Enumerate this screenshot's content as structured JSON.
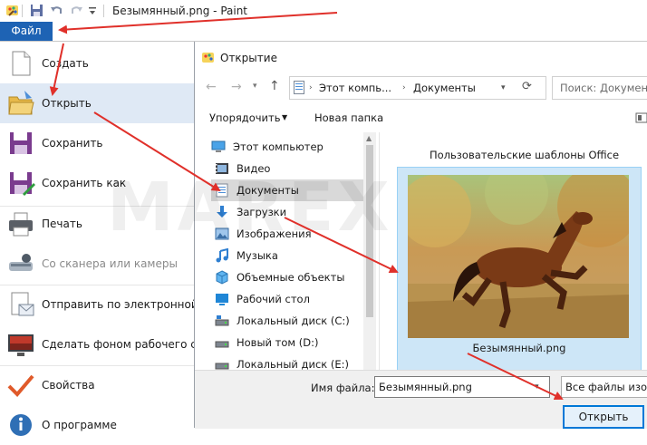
{
  "app": {
    "window_title": "Безымянный.png - Paint",
    "file_tab": "Файл"
  },
  "file_menu": {
    "items": [
      {
        "label": "Создать",
        "icon": "new-document-icon"
      },
      {
        "label": "Открыть",
        "icon": "open-folder-icon"
      },
      {
        "label": "Сохранить",
        "icon": "save-disk-icon"
      },
      {
        "label": "Сохранить как",
        "icon": "save-as-icon"
      },
      {
        "label": "Печать",
        "icon": "printer-icon"
      },
      {
        "label": "Со сканера или камеры",
        "icon": "scanner-icon"
      },
      {
        "label": "Отправить по электронной по",
        "icon": "email-icon"
      },
      {
        "label": "Сделать фоном рабочего стол",
        "icon": "desktop-background-icon"
      },
      {
        "label": "Свойства",
        "icon": "checkmark-icon"
      },
      {
        "label": "О программе",
        "icon": "info-icon"
      }
    ]
  },
  "dialog": {
    "title": "Открытие",
    "address": {
      "crumb1": "Этот компь...",
      "crumb2": "Документы",
      "search_placeholder": "Поиск: Документы"
    },
    "toolbar": {
      "organize": "Упорядочить",
      "new_folder": "Новая папка"
    },
    "nav": [
      {
        "label": "Этот компьютер",
        "icon": "computer-icon"
      },
      {
        "label": "Видео",
        "icon": "video-icon"
      },
      {
        "label": "Документы",
        "icon": "documents-icon"
      },
      {
        "label": "Загрузки",
        "icon": "downloads-icon"
      },
      {
        "label": "Изображения",
        "icon": "pictures-icon"
      },
      {
        "label": "Музыка",
        "icon": "music-icon"
      },
      {
        "label": "Объемные объекты",
        "icon": "3d-objects-icon"
      },
      {
        "label": "Рабочий стол",
        "icon": "desktop-icon"
      },
      {
        "label": "Локальный диск (C:)",
        "icon": "drive-icon"
      },
      {
        "label": "Новый том (D:)",
        "icon": "drive-icon"
      },
      {
        "label": "Локальный диск (E:)",
        "icon": "drive-icon"
      }
    ],
    "content": {
      "folder_label": "Пользовательские шаблоны Office",
      "file_label": "Безымянный.png"
    },
    "bottom": {
      "filename_label": "Имя файла:",
      "filename_value": "Безымянный.png",
      "filter": "Все файлы изоб",
      "open_button": "Открыть"
    }
  },
  "watermark": "MAREX",
  "colors": {
    "accent": "#1e63b4",
    "arrow": "#e0302a",
    "active_item": "#dfe9f5"
  }
}
